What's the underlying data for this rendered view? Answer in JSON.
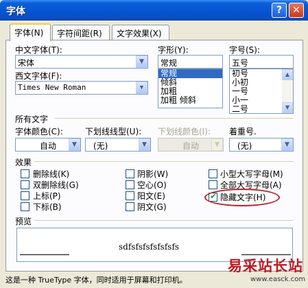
{
  "window": {
    "title": "字体",
    "help": "?",
    "close": "✕"
  },
  "tabs": [
    {
      "label": "字体(N)"
    },
    {
      "label": "字符间距(R)"
    },
    {
      "label": "文字效果(X)"
    }
  ],
  "chinese_font": {
    "label": "中文字体(T):",
    "value": "宋体"
  },
  "western_font": {
    "label": "西文字体(F):",
    "value": "Times New Roman"
  },
  "font_style": {
    "label": "字形(Y):",
    "value": "常规",
    "options": [
      "常规",
      "倾斜",
      "加粗",
      "加粗 倾斜"
    ]
  },
  "font_size": {
    "label": "字号(S):",
    "value": "五号",
    "options": [
      "初号",
      "小初",
      "一号",
      "小一",
      "二号"
    ]
  },
  "all_text": {
    "title": "所有文字",
    "font_color": {
      "label": "字体颜色(C):",
      "value": "自动"
    },
    "underline": {
      "label": "下划线线型(U):",
      "value": "(无)"
    },
    "underline_color": {
      "label": "下划线颜色(I):",
      "value": "自动"
    },
    "emphasis": {
      "label": "着重号.",
      "value": "(无)"
    }
  },
  "effects": {
    "title": "效果",
    "col1": [
      {
        "label": "删除线(K)",
        "checked": false
      },
      {
        "label": "双删除线(G)",
        "checked": false
      },
      {
        "label": "上标(P)",
        "checked": false
      },
      {
        "label": "下标(B)",
        "checked": false
      }
    ],
    "col2": [
      {
        "label": "阴影(W)",
        "checked": false
      },
      {
        "label": "空心(O)",
        "checked": false
      },
      {
        "label": "阳文(E)",
        "checked": false
      },
      {
        "label": "阴文(G)",
        "checked": false
      }
    ],
    "col3": [
      {
        "label": "小型大写字母(M)",
        "checked": false
      },
      {
        "label": "全部大写字母(A)",
        "checked": false
      },
      {
        "label": "隐藏文字(H)",
        "checked": true
      }
    ]
  },
  "preview": {
    "title": "预览",
    "sample": "sdfsfsfsfsfsfsfs"
  },
  "footer_note": "这是一种 TrueType 字体，同时适用于屏幕和打印机。",
  "watermark": {
    "cn": "易采站长站",
    "url": "www.easck.com"
  },
  "colors": {
    "titlebar": "#0553d0",
    "selection": "#316ac5",
    "annotation": "#b8232a",
    "watermark": "#c0181f"
  }
}
